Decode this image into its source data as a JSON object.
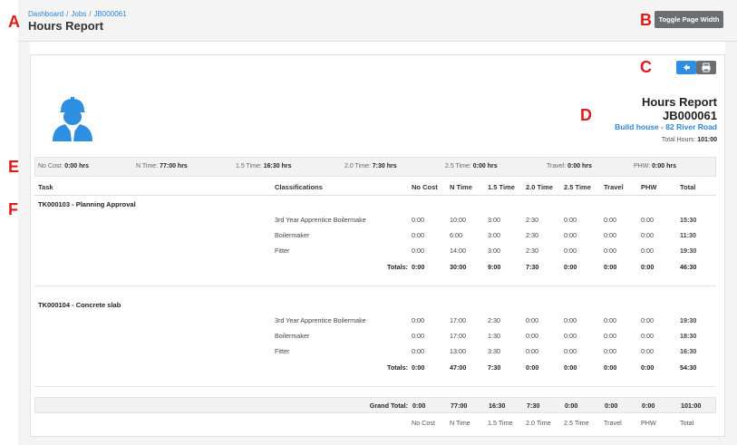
{
  "breadcrumb": [
    "Dashboard",
    "Jobs",
    "JB000061"
  ],
  "page_title": "Hours Report",
  "toggle_label": "Toggle Page Width",
  "markers": {
    "a": "A",
    "b": "B",
    "c": "C",
    "d": "D",
    "e": "E",
    "f": "F"
  },
  "report": {
    "title": "Hours Report",
    "job": "JB000061",
    "address": "Build house - 82 River Road",
    "total_label": "Total Hours:",
    "total_value": "101:00"
  },
  "summary": [
    {
      "label": "No Cost:",
      "value": "0:00 hrs"
    },
    {
      "label": "N Time:",
      "value": "77:00 hrs"
    },
    {
      "label": "1.5 Time:",
      "value": "16:30 hrs"
    },
    {
      "label": "2.0 Time:",
      "value": "7:30 hrs"
    },
    {
      "label": "2.5 Time:",
      "value": "0:00 hrs"
    },
    {
      "label": "Travel:",
      "value": "0:00 hrs"
    },
    {
      "label": "PHW:",
      "value": "0:00 hrs"
    }
  ],
  "headers": {
    "task": "Task",
    "classifications": "Classifications",
    "no_cost": "No Cost",
    "n_time": "N Time",
    "t15": "1.5 Time",
    "t20": "2.0 Time",
    "t25": "2.5 Time",
    "travel": "Travel",
    "phw": "PHW",
    "total": "Total"
  },
  "tasks": [
    {
      "title": "TK000103 - Planning Approval",
      "rows": [
        {
          "classification": "3rd Year Apprentice Boilermake",
          "no_cost": "0:00",
          "n_time": "10:00",
          "t15": "3:00",
          "t20": "2:30",
          "t25": "0:00",
          "travel": "0:00",
          "phw": "0:00",
          "total": "15:30"
        },
        {
          "classification": "Boilermaker",
          "no_cost": "0:00",
          "n_time": "6:00",
          "t15": "3:00",
          "t20": "2:30",
          "t25": "0:00",
          "travel": "0:00",
          "phw": "0:00",
          "total": "11:30"
        },
        {
          "classification": "Fitter",
          "no_cost": "0:00",
          "n_time": "14:00",
          "t15": "3:00",
          "t20": "2:30",
          "t25": "0:00",
          "travel": "0:00",
          "phw": "0:00",
          "total": "19:30"
        }
      ],
      "totals": {
        "label": "Totals:",
        "no_cost": "0:00",
        "n_time": "30:00",
        "t15": "9:00",
        "t20": "7:30",
        "t25": "0:00",
        "travel": "0:00",
        "phw": "0:00",
        "total": "46:30"
      }
    },
    {
      "title": "TK000104 - Concrete slab",
      "rows": [
        {
          "classification": "3rd Year Apprentice Boilermake",
          "no_cost": "0:00",
          "n_time": "17:00",
          "t15": "2:30",
          "t20": "0:00",
          "t25": "0:00",
          "travel": "0:00",
          "phw": "0:00",
          "total": "19:30"
        },
        {
          "classification": "Boilermaker",
          "no_cost": "0:00",
          "n_time": "17:00",
          "t15": "1:30",
          "t20": "0:00",
          "t25": "0:00",
          "travel": "0:00",
          "phw": "0:00",
          "total": "18:30"
        },
        {
          "classification": "Fitter",
          "no_cost": "0:00",
          "n_time": "13:00",
          "t15": "3:30",
          "t20": "0:00",
          "t25": "0:00",
          "travel": "0:00",
          "phw": "0:00",
          "total": "16:30"
        }
      ],
      "totals": {
        "label": "Totals:",
        "no_cost": "0:00",
        "n_time": "47:00",
        "t15": "7:30",
        "t20": "0:00",
        "t25": "0:00",
        "travel": "0:00",
        "phw": "0:00",
        "total": "54:30"
      }
    }
  ],
  "grand_total": {
    "label": "Grand Total:",
    "no_cost": "0:00",
    "n_time": "77:00",
    "t15": "16:30",
    "t20": "7:30",
    "t25": "0:00",
    "travel": "0:00",
    "phw": "0:00",
    "total": "101:00"
  },
  "footer": {
    "no_cost": "No Cost",
    "n_time": "N Time",
    "t15": "1.5 Time",
    "t20": "2.0 Time",
    "t25": "2.5 Time",
    "travel": "Travel",
    "phw": "PHW",
    "total": "Total"
  },
  "icons": {
    "back": "back-arrow-icon",
    "print": "printer-icon",
    "avatar": "worker-avatar-icon"
  },
  "colors": {
    "accent": "#2e8ee0",
    "link": "#2e86d6",
    "button_gray": "#6b6f73",
    "marker_red": "#e01b1b"
  }
}
